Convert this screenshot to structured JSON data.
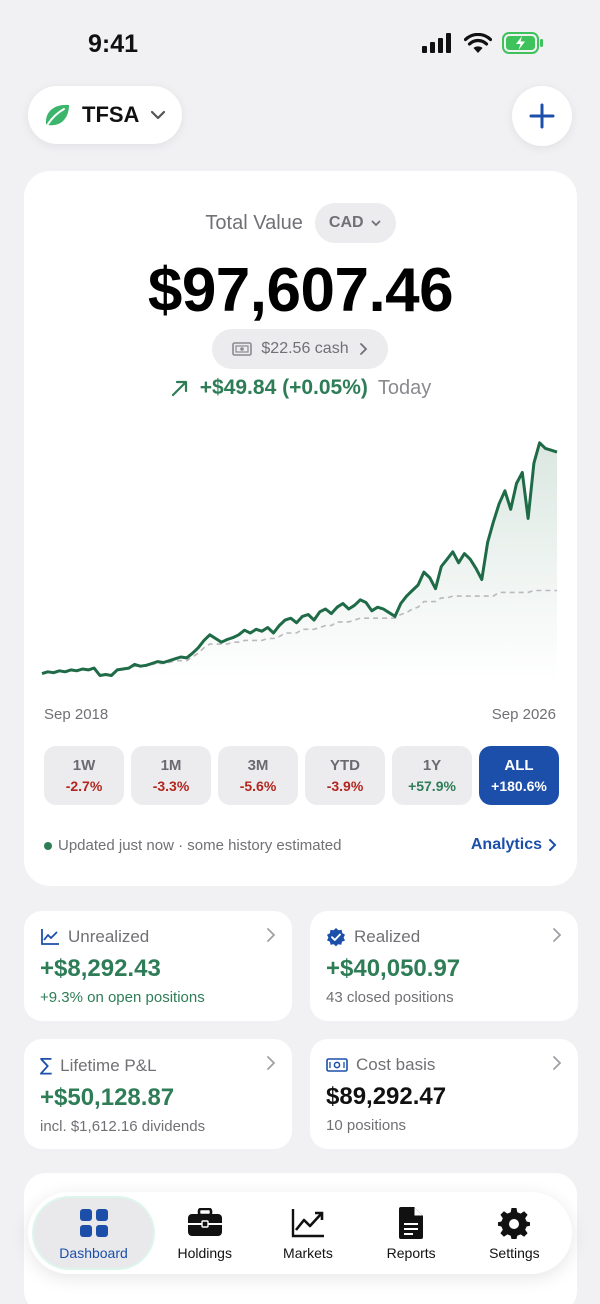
{
  "status_bar": {
    "time": "9:41"
  },
  "account": {
    "name": "TFSA"
  },
  "summary": {
    "total_label": "Total Value",
    "currency": "CAD",
    "total_value": "$97,607.46",
    "cash": "$22.56 cash",
    "today_change": "+$49.84 (+0.05%)",
    "today_label": "Today"
  },
  "chart_data": {
    "type": "line",
    "x_start_label": "Sep 2018",
    "x_end_label": "Sep 2026",
    "series": [
      {
        "values": [
          8,
          10,
          9,
          11,
          10,
          12,
          11,
          13,
          12,
          14,
          6,
          7,
          6,
          12,
          13,
          14,
          18,
          16,
          17,
          19,
          21,
          20,
          22,
          24,
          26,
          25,
          30,
          36,
          44,
          50,
          46,
          42,
          45,
          47,
          50,
          55,
          52,
          56,
          54,
          58,
          52,
          60,
          66,
          68,
          63,
          70,
          72,
          66,
          75,
          78,
          73,
          80,
          84,
          78,
          82,
          88,
          85,
          76,
          80,
          78,
          74,
          70,
          84,
          92,
          98,
          104,
          118,
          112,
          100,
          124,
          132,
          140,
          128,
          138,
          132,
          122,
          110,
          150,
          172,
          192,
          206,
          186,
          214,
          226,
          176,
          236,
          258,
          252,
          250,
          248
        ]
      },
      {
        "values": [
          8,
          10,
          9,
          11,
          10,
          12,
          11,
          13,
          12,
          14,
          6,
          7,
          6,
          12,
          13,
          14,
          16,
          16,
          16,
          18,
          19,
          19,
          20,
          22,
          22,
          22,
          26,
          30,
          36,
          40,
          40,
          40,
          40,
          42,
          42,
          44,
          44,
          44,
          44,
          46,
          46,
          48,
          52,
          52,
          52,
          56,
          56,
          56,
          58,
          60,
          60,
          64,
          64,
          64,
          66,
          68,
          68,
          68,
          68,
          68,
          68,
          68,
          72,
          74,
          78,
          80,
          86,
          86,
          86,
          90,
          90,
          92,
          92,
          92,
          92,
          92,
          92,
          92,
          92,
          96,
          96,
          96,
          96,
          96,
          96,
          98,
          98,
          98,
          98,
          98
        ]
      }
    ]
  },
  "ranges": [
    {
      "label": "1W",
      "value": "-2.7%",
      "tone": "neg",
      "active": false
    },
    {
      "label": "1M",
      "value": "-3.3%",
      "tone": "neg",
      "active": false
    },
    {
      "label": "3M",
      "value": "-5.6%",
      "tone": "neg",
      "active": false
    },
    {
      "label": "YTD",
      "value": "-3.9%",
      "tone": "neg",
      "active": false
    },
    {
      "label": "1Y",
      "value": "+57.9%",
      "tone": "pos",
      "active": false
    },
    {
      "label": "ALL",
      "value": "+180.6%",
      "tone": "pos",
      "active": true
    }
  ],
  "footer": {
    "updated": "Updated just now · some history estimated",
    "analytics": "Analytics"
  },
  "stats": {
    "unrealized": {
      "label": "Unrealized",
      "value": "+$8,292.43",
      "sub": "+9.3% on open positions"
    },
    "realized": {
      "label": "Realized",
      "value": "+$40,050.97",
      "sub": "43 closed positions"
    },
    "lifetime": {
      "label": "Lifetime P&L",
      "value": "+$50,128.87",
      "sub": "incl. $1,612.16 dividends"
    },
    "cost_basis": {
      "label": "Cost basis",
      "value": "$89,292.47",
      "sub": "10 positions"
    }
  },
  "tabs": [
    {
      "label": "Dashboard",
      "icon": "grid-icon",
      "active": true
    },
    {
      "label": "Holdings",
      "icon": "briefcase-icon",
      "active": false
    },
    {
      "label": "Markets",
      "icon": "trend-chart-icon",
      "active": false
    },
    {
      "label": "Reports",
      "icon": "document-icon",
      "active": false
    },
    {
      "label": "Settings",
      "icon": "gear-icon",
      "active": false
    }
  ],
  "colors": {
    "accent": "#1c4faa",
    "positive": "#2e7d57",
    "negative": "#b3261e",
    "chart_line": "#1f6b47"
  }
}
